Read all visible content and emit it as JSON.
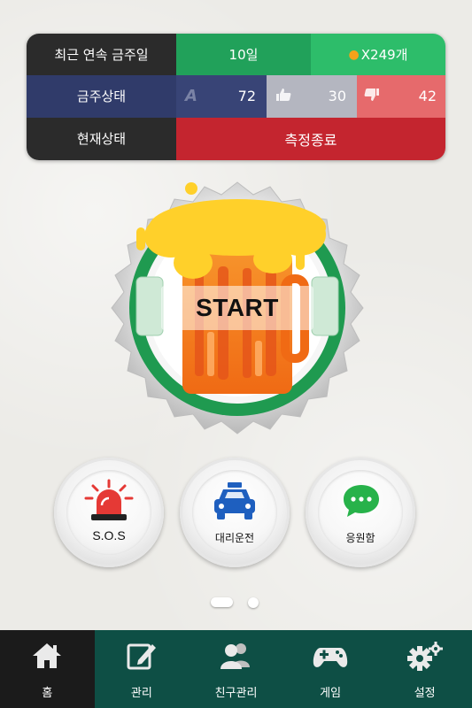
{
  "status": {
    "streak_label": "최근 연속 금주일",
    "streak_value": "10일",
    "reward_value": "X249개",
    "state_label": "금주상태",
    "grade": "A",
    "grade_score": "72",
    "likes": "30",
    "dislikes": "42",
    "current_label": "현재상태",
    "current_value": "측정종료"
  },
  "main": {
    "start_label": "START"
  },
  "actions": [
    {
      "label": "S.O.S"
    },
    {
      "label": "대리운전"
    },
    {
      "label": "응원함"
    }
  ],
  "pager": {
    "pages": 2,
    "current": 1
  },
  "tabs": [
    {
      "label": "홈"
    },
    {
      "label": "관리"
    },
    {
      "label": "친구관리"
    },
    {
      "label": "게임"
    },
    {
      "label": "설정"
    }
  ],
  "colors": {
    "streak_green": "#21a15a",
    "alert_red": "#c4252f",
    "tabbar_green": "#0e4f45",
    "grade_blue": "#303b6a"
  }
}
